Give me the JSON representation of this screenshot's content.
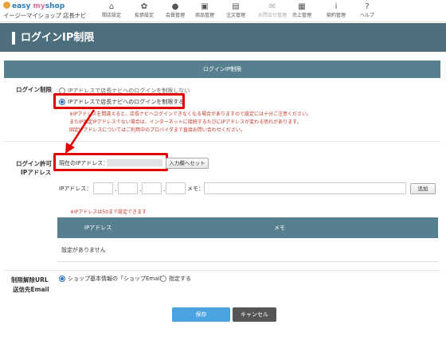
{
  "logo": {
    "brand_easy": "easy",
    "brand_my": "my",
    "brand_shop": "shop",
    "subtitle": "イージーマイショップ 店長ナビ"
  },
  "nav": [
    {
      "label": "開店設定",
      "icon": "home-icon",
      "glyph": "⌂"
    },
    {
      "label": "拡張設定",
      "icon": "gear-icon",
      "glyph": "✿"
    },
    {
      "label": "会員管理",
      "icon": "person-icon",
      "glyph": "●"
    },
    {
      "label": "商品管理",
      "icon": "gift-icon",
      "glyph": "▣"
    },
    {
      "label": "注文管理",
      "icon": "document-icon",
      "glyph": "▤"
    },
    {
      "label": "お問合せ管理",
      "icon": "mail-icon",
      "glyph": "✉"
    },
    {
      "label": "売上管理",
      "icon": "calculator-icon",
      "glyph": "▦"
    },
    {
      "label": "契約管理",
      "icon": "info-icon",
      "glyph": "i"
    },
    {
      "label": "ヘルプ",
      "icon": "question-icon",
      "glyph": "?"
    }
  ],
  "page_title": "ログインIP制限",
  "section_title": "ログインIP制限",
  "login_restriction": {
    "label": "ログイン制限",
    "options": [
      {
        "label": "IPアドレスで店長ナビへのログインを制限しない",
        "checked": false
      },
      {
        "label": "IPアドレスで店長ナビへのログインを制限する",
        "checked": true
      }
    ],
    "notes": [
      "※IPアドレスを間違えると、店長ナビへログインできなくなる場合がありますので設定には十分ご注意ください。",
      "またIP固定IPアドレスでない場合は、インターネットに接続するたびにIPアドレスが変わる恐れがあります。",
      "固定IPアドレスについてはご利用中のプロバイダまで直接お問い合わせください。"
    ]
  },
  "allowed_ip": {
    "label_line1": "ログイン許可",
    "label_line2": "IPアドレス",
    "current_ip_label": "現在のIPアドレス：",
    "set_to_input_button": "入力欄へセット",
    "ip_label": "IPアドレス：",
    "dot": ".",
    "memo_label": "メモ：",
    "add_button": "追加",
    "max_note": "※IPアドレスは50まで設定できます",
    "table_headers": [
      "IPアドレス",
      "メモ"
    ],
    "empty_text": "設定がありません"
  },
  "unlock_url": {
    "label_line1": "制限解除URL",
    "label_line2": "送信先Email",
    "options": [
      {
        "label": "ショップ基本情報の「ショップEmail」",
        "checked": true
      },
      {
        "label": "指定する",
        "checked": false
      }
    ]
  },
  "buttons": {
    "save": "保存",
    "cancel": "キャンセル"
  },
  "colors": {
    "header": "#4d6e7d",
    "section": "#56808f",
    "accent_blue": "#4aa3df",
    "highlight": "#e00000",
    "note_red": "#c0392b"
  }
}
